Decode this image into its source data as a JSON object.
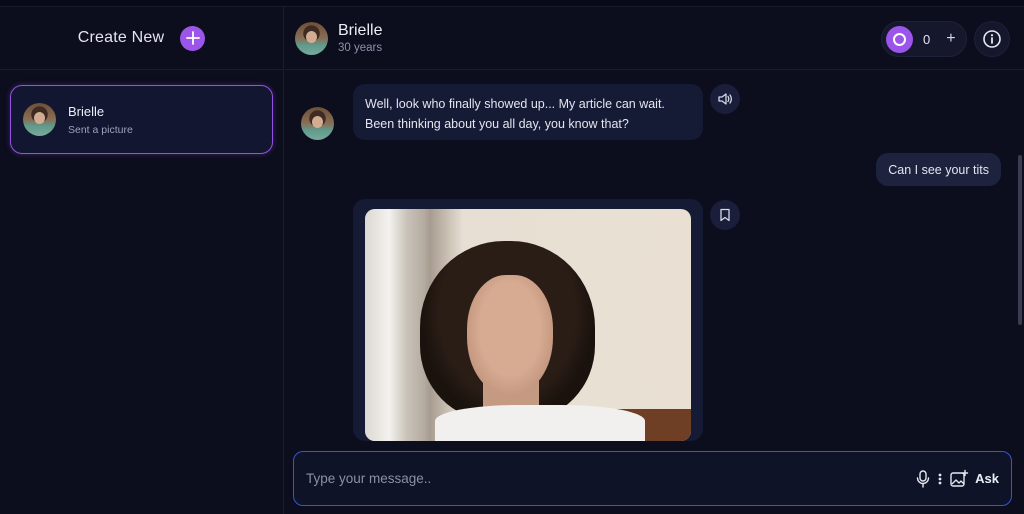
{
  "sidebar": {
    "create_label": "Create New",
    "chats": [
      {
        "name": "Brielle",
        "preview": "Sent a picture"
      }
    ]
  },
  "header": {
    "name": "Brielle",
    "age": "30 years",
    "coins": "0",
    "coin_add": "+"
  },
  "messages": {
    "ai_text": "Well, look who finally showed up... My article can wait. Been thinking about you all day, you know that?",
    "user_text": "Can I see your tits"
  },
  "composer": {
    "placeholder": "Type your message..",
    "ask_label": "Ask"
  },
  "colors": {
    "accent": "#9b55e9",
    "background": "#0c0d1d",
    "bubble": "#161b35",
    "input_border": "#3a55c7"
  },
  "icons": [
    "plus-icon",
    "info-icon",
    "speaker-icon",
    "bookmark-icon",
    "microphone-icon",
    "image-sparkle-icon",
    "coin-icon"
  ]
}
